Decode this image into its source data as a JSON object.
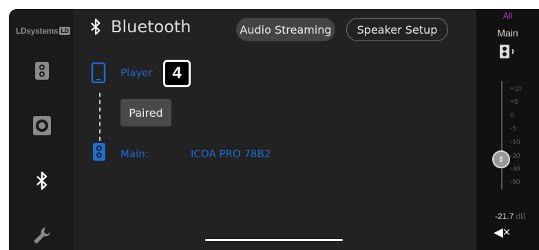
{
  "brand": {
    "name": "LDsystems",
    "mark": "LD"
  },
  "header": {
    "title": "Bluetooth",
    "tabs": [
      {
        "label": "Audio Streaming",
        "active": true
      },
      {
        "label": "Speaker Setup",
        "active": false
      }
    ]
  },
  "sidebar": {
    "items": [
      {
        "icon": "speaker-column-icon"
      },
      {
        "icon": "subwoofer-icon"
      },
      {
        "icon": "bluetooth-icon",
        "active": true
      },
      {
        "icon": "wrench-icon"
      }
    ]
  },
  "connection": {
    "source_label": "Player",
    "step_badge": "4",
    "status": "Paired",
    "target_label": "Main:",
    "target_device": "ICOA PRO 78B2"
  },
  "mixer": {
    "group": "All",
    "channel": "Main",
    "scale": [
      "+10",
      "+5",
      "0",
      "-5",
      "-10",
      "-20",
      "-40",
      "-80"
    ],
    "level": "-21.7",
    "unit": "dB",
    "muted": true
  },
  "colors": {
    "accent": "#1f6cd4",
    "group": "#b040e0",
    "background": "#222222"
  }
}
